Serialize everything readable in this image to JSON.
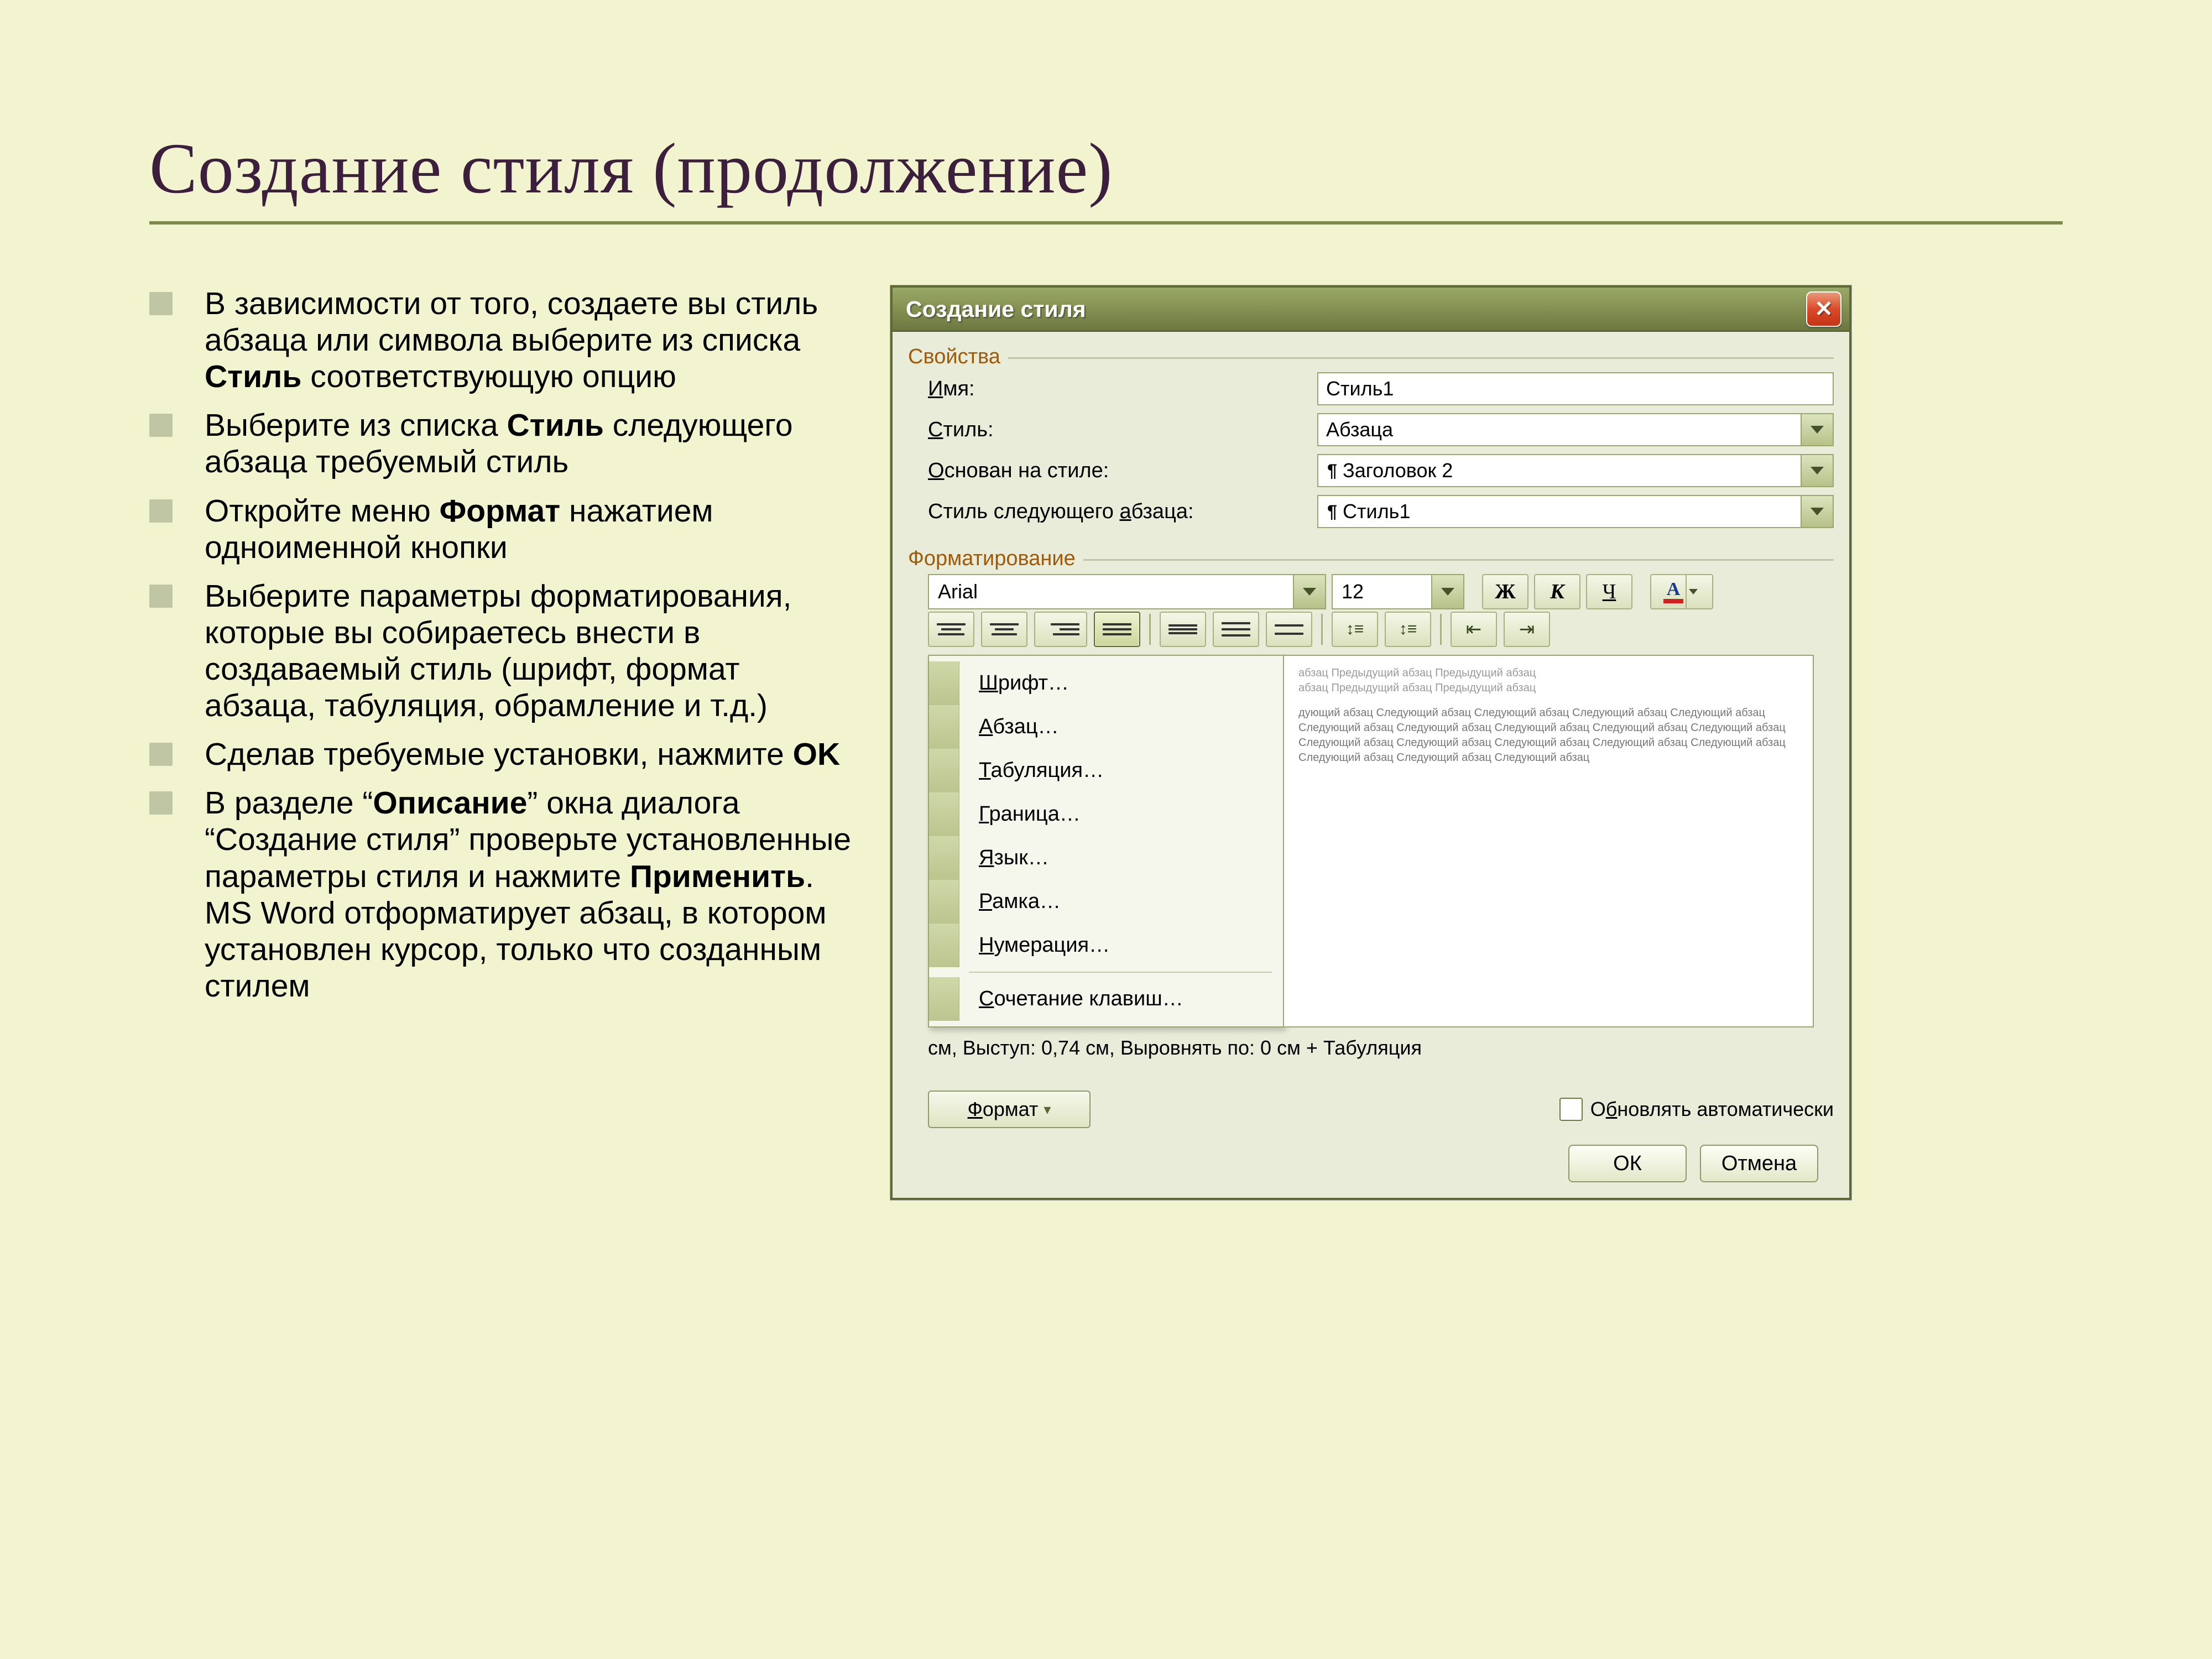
{
  "title": "Создание стиля (продолжение)",
  "bullets": [
    "В зависимости от того, создаете вы стиль абзаца или символа выберите из списка <b>Стиль</b> соответствующую опцию",
    "Выберите из списка <b>Стиль</b> следующего абзаца требуемый стиль",
    "Откройте меню <b>Формат</b> нажатием одноименной кнопки",
    "Выберите параметры форматирования, которые вы собираетесь внести в создаваемый стиль (шрифт, формат абзаца, табуляция, обрамление и т.д.)",
    "Сделав требуемые установки, нажмите <b>OK</b>",
    "В разделе “<b>Описание</b>” окна диалога “Создание стиля” проверьте установленные параметры стиля и нажмите <b>Применить</b>. MS Word отформатирует абзац, в котором установлен курсор, только что созданным стилем"
  ],
  "dialog": {
    "title": "Создание стиля",
    "groups": {
      "props": "Свойства",
      "format": "Форматирование"
    },
    "labels": {
      "name": "Имя:",
      "style": "Стиль:",
      "based": "Основан на стиле:",
      "next": "Стиль следующего абзаца:"
    },
    "values": {
      "name": "Стиль1",
      "style": "Абзаца",
      "based": "Заголовок 2",
      "next": "Стиль1"
    },
    "font": "Arial",
    "size": "12",
    "biu": {
      "b": "Ж",
      "i": "К",
      "u": "Ч",
      "a": "A"
    },
    "menu": {
      "font": "Шрифт…",
      "para": "Абзац…",
      "tabs": "Табуляция…",
      "border": "Граница…",
      "lang": "Язык…",
      "frame": "Рамка…",
      "number": "Нумерация…",
      "keys": "Сочетание клавиш…"
    },
    "preview1": "абзац Предыдущий абзац Предыдущий абзац",
    "preview1b": "абзац Предыдущий абзац Предыдущий абзац",
    "preview2": "дующий абзац Следующий абзац Следующий абзац Следующий абзац Следующий абзац Следующий абзац Следующий абзац Следующий абзац Следующий абзац Следующий абзац Следующий абзац Следующий абзац Следующий абзац Следующий абзац Следующий абзац Следующий абзац Следующий абзац Следующий абзац",
    "desc": "см, Выступ:  0,74 см, Выровнять по:  0 см + Табуляция",
    "formatBtn": "Формат",
    "autoupdate": "Обновлять автоматически",
    "ok": "ОК",
    "cancel": "Отмена"
  }
}
